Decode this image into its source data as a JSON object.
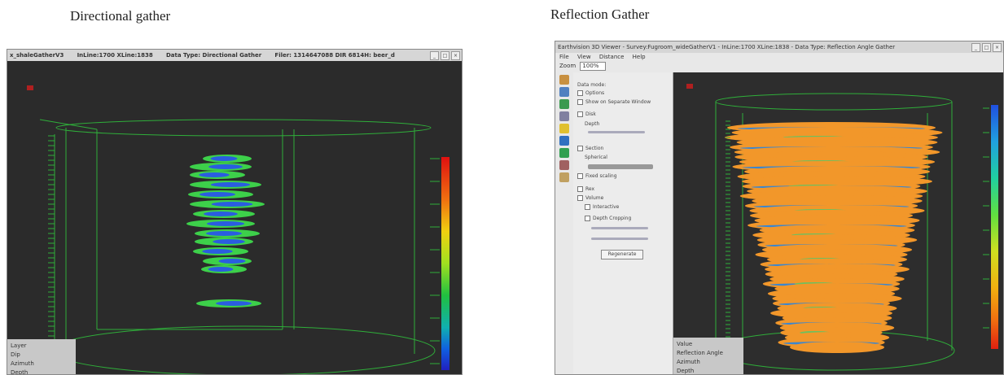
{
  "captions": {
    "left": "Directional gather",
    "right": "Reflection Gather"
  },
  "left_window": {
    "title_segments": [
      "x_shaleGatherV3",
      "InLine:1700 XLine:1838",
      "Data Type: Directional Gather",
      "Filer: 1314647088 DIR 6814H: beer_d"
    ],
    "legend_items": [
      "Layer",
      "Dip",
      "Azimuth",
      "Depth"
    ],
    "colorbar_colors": [
      "#e01010",
      "#f07010",
      "#f0d010",
      "#a0e020",
      "#20c040",
      "#10b0b0",
      "#1060e0",
      "#2020c0"
    ]
  },
  "right_window": {
    "title": "Earthvision 3D Viewer - Survey:Fugroom_wideGatherV1 - InLine:1700 XLine:1838 - Data Type: Reflection Angle Gather",
    "menu": [
      "File",
      "View",
      "Distance",
      "Help"
    ],
    "zoom_label": "Zoom",
    "zoom_value": "100%",
    "panel_rows": [
      "Data mode:",
      "Options",
      "Show on Separate Window",
      "Disk",
      "Depth",
      "Section",
      "Spherical",
      "Fixed scaling",
      "Rex",
      "Volume",
      "Interactive",
      "Depth Cropping"
    ],
    "panel_button": "Regenerate",
    "legend_items": [
      "Value",
      "Reflection Angle",
      "Azimuth",
      "Depth"
    ],
    "colorbar_colors": [
      "#2050e0",
      "#20a0e0",
      "#20d0a0",
      "#60e040",
      "#d0e020",
      "#f0b010",
      "#f07010",
      "#e02010"
    ]
  },
  "icons": [
    "close-icon",
    "minimize-icon",
    "maximize-icon",
    "home-icon",
    "rotate-icon",
    "zoom-icon",
    "light-icon",
    "cursor-icon",
    "camera-icon"
  ]
}
